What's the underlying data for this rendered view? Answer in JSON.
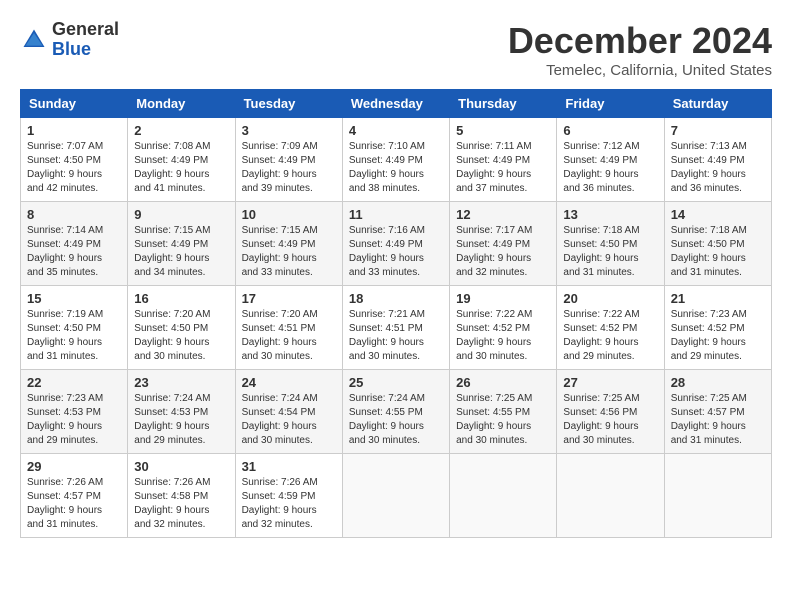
{
  "logo": {
    "general": "General",
    "blue": "Blue"
  },
  "title": "December 2024",
  "subtitle": "Temelec, California, United States",
  "weekdays": [
    "Sunday",
    "Monday",
    "Tuesday",
    "Wednesday",
    "Thursday",
    "Friday",
    "Saturday"
  ],
  "weeks": [
    [
      {
        "day": "1",
        "sunrise": "7:07 AM",
        "sunset": "4:50 PM",
        "daylight": "9 hours and 42 minutes."
      },
      {
        "day": "2",
        "sunrise": "7:08 AM",
        "sunset": "4:49 PM",
        "daylight": "9 hours and 41 minutes."
      },
      {
        "day": "3",
        "sunrise": "7:09 AM",
        "sunset": "4:49 PM",
        "daylight": "9 hours and 39 minutes."
      },
      {
        "day": "4",
        "sunrise": "7:10 AM",
        "sunset": "4:49 PM",
        "daylight": "9 hours and 38 minutes."
      },
      {
        "day": "5",
        "sunrise": "7:11 AM",
        "sunset": "4:49 PM",
        "daylight": "9 hours and 37 minutes."
      },
      {
        "day": "6",
        "sunrise": "7:12 AM",
        "sunset": "4:49 PM",
        "daylight": "9 hours and 36 minutes."
      },
      {
        "day": "7",
        "sunrise": "7:13 AM",
        "sunset": "4:49 PM",
        "daylight": "9 hours and 36 minutes."
      }
    ],
    [
      {
        "day": "8",
        "sunrise": "7:14 AM",
        "sunset": "4:49 PM",
        "daylight": "9 hours and 35 minutes."
      },
      {
        "day": "9",
        "sunrise": "7:15 AM",
        "sunset": "4:49 PM",
        "daylight": "9 hours and 34 minutes."
      },
      {
        "day": "10",
        "sunrise": "7:15 AM",
        "sunset": "4:49 PM",
        "daylight": "9 hours and 33 minutes."
      },
      {
        "day": "11",
        "sunrise": "7:16 AM",
        "sunset": "4:49 PM",
        "daylight": "9 hours and 33 minutes."
      },
      {
        "day": "12",
        "sunrise": "7:17 AM",
        "sunset": "4:49 PM",
        "daylight": "9 hours and 32 minutes."
      },
      {
        "day": "13",
        "sunrise": "7:18 AM",
        "sunset": "4:50 PM",
        "daylight": "9 hours and 31 minutes."
      },
      {
        "day": "14",
        "sunrise": "7:18 AM",
        "sunset": "4:50 PM",
        "daylight": "9 hours and 31 minutes."
      }
    ],
    [
      {
        "day": "15",
        "sunrise": "7:19 AM",
        "sunset": "4:50 PM",
        "daylight": "9 hours and 31 minutes."
      },
      {
        "day": "16",
        "sunrise": "7:20 AM",
        "sunset": "4:50 PM",
        "daylight": "9 hours and 30 minutes."
      },
      {
        "day": "17",
        "sunrise": "7:20 AM",
        "sunset": "4:51 PM",
        "daylight": "9 hours and 30 minutes."
      },
      {
        "day": "18",
        "sunrise": "7:21 AM",
        "sunset": "4:51 PM",
        "daylight": "9 hours and 30 minutes."
      },
      {
        "day": "19",
        "sunrise": "7:22 AM",
        "sunset": "4:52 PM",
        "daylight": "9 hours and 30 minutes."
      },
      {
        "day": "20",
        "sunrise": "7:22 AM",
        "sunset": "4:52 PM",
        "daylight": "9 hours and 29 minutes."
      },
      {
        "day": "21",
        "sunrise": "7:23 AM",
        "sunset": "4:52 PM",
        "daylight": "9 hours and 29 minutes."
      }
    ],
    [
      {
        "day": "22",
        "sunrise": "7:23 AM",
        "sunset": "4:53 PM",
        "daylight": "9 hours and 29 minutes."
      },
      {
        "day": "23",
        "sunrise": "7:24 AM",
        "sunset": "4:53 PM",
        "daylight": "9 hours and 29 minutes."
      },
      {
        "day": "24",
        "sunrise": "7:24 AM",
        "sunset": "4:54 PM",
        "daylight": "9 hours and 30 minutes."
      },
      {
        "day": "25",
        "sunrise": "7:24 AM",
        "sunset": "4:55 PM",
        "daylight": "9 hours and 30 minutes."
      },
      {
        "day": "26",
        "sunrise": "7:25 AM",
        "sunset": "4:55 PM",
        "daylight": "9 hours and 30 minutes."
      },
      {
        "day": "27",
        "sunrise": "7:25 AM",
        "sunset": "4:56 PM",
        "daylight": "9 hours and 30 minutes."
      },
      {
        "day": "28",
        "sunrise": "7:25 AM",
        "sunset": "4:57 PM",
        "daylight": "9 hours and 31 minutes."
      }
    ],
    [
      {
        "day": "29",
        "sunrise": "7:26 AM",
        "sunset": "4:57 PM",
        "daylight": "9 hours and 31 minutes."
      },
      {
        "day": "30",
        "sunrise": "7:26 AM",
        "sunset": "4:58 PM",
        "daylight": "9 hours and 32 minutes."
      },
      {
        "day": "31",
        "sunrise": "7:26 AM",
        "sunset": "4:59 PM",
        "daylight": "9 hours and 32 minutes."
      },
      null,
      null,
      null,
      null
    ]
  ]
}
